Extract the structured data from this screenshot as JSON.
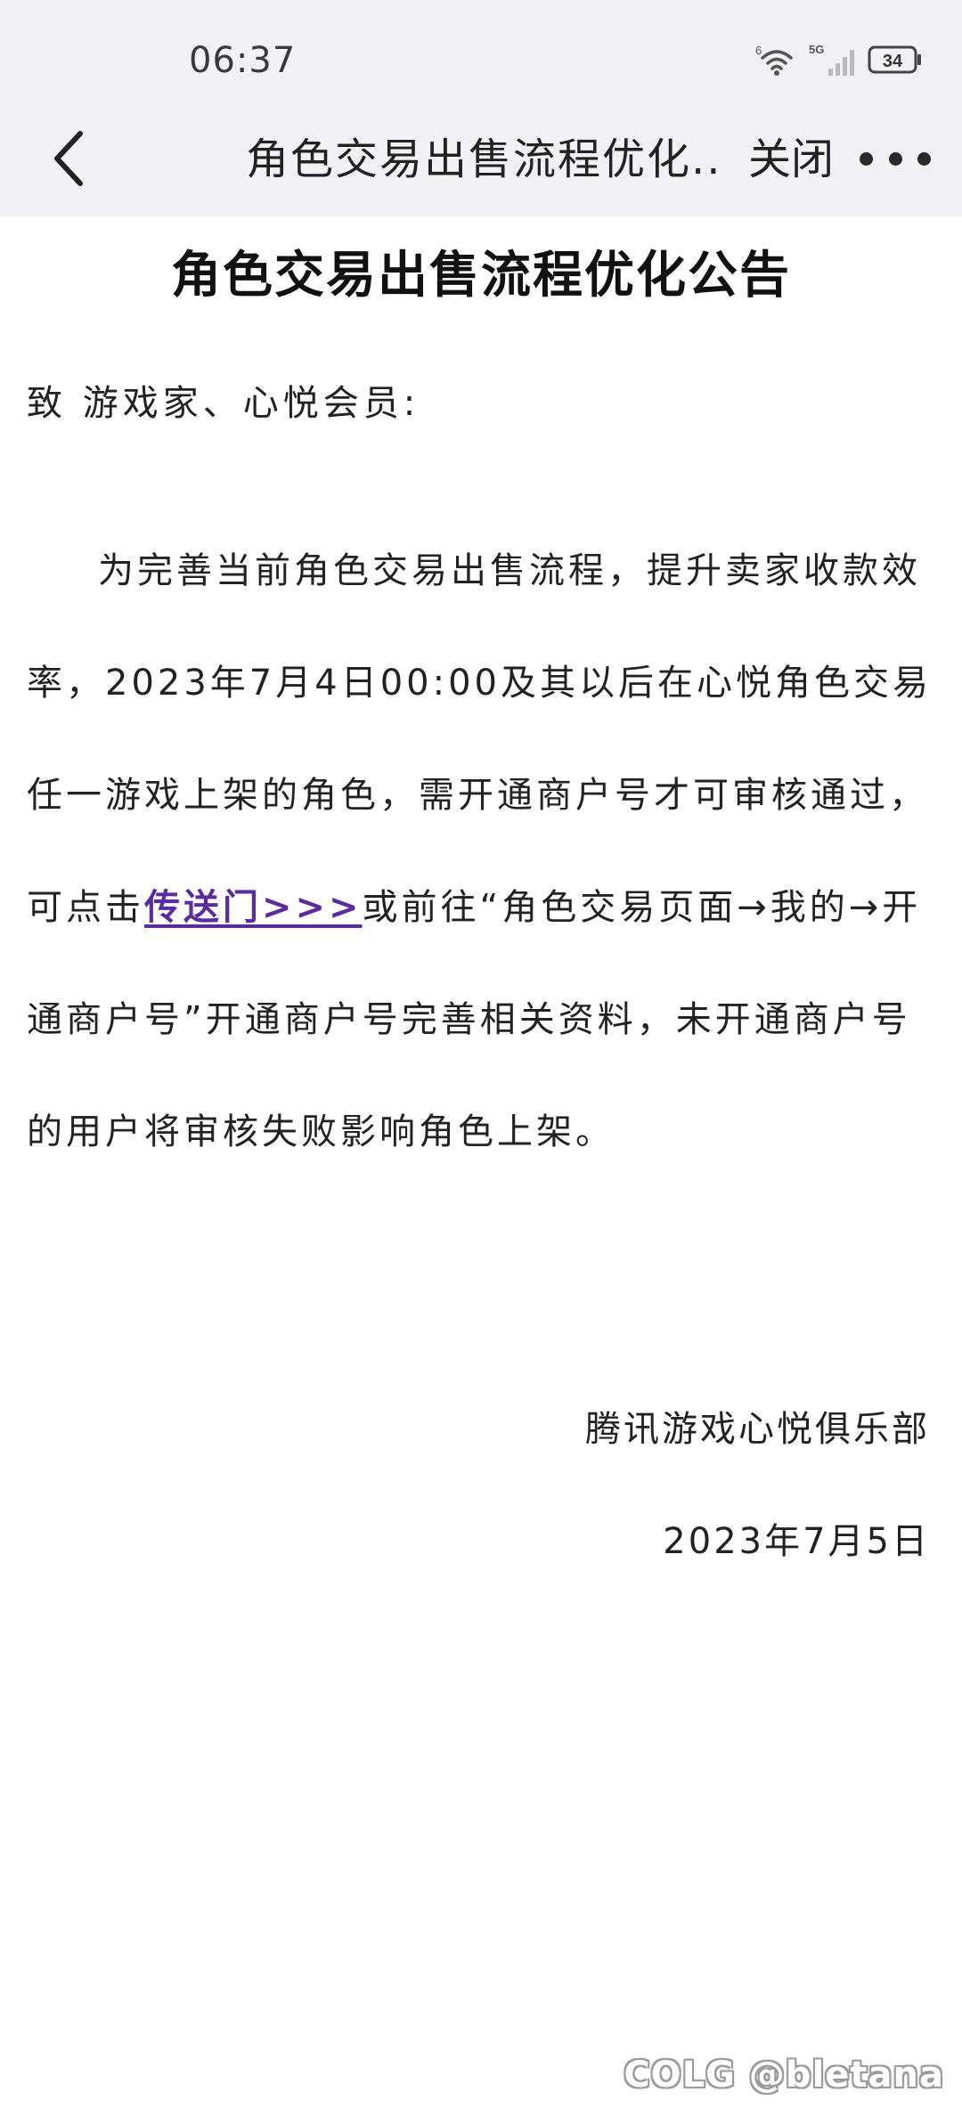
{
  "status_bar": {
    "time": "06:37",
    "wifi_label": "6",
    "network_label": "5G",
    "battery": "34"
  },
  "header": {
    "title": "角色交易出售流程优化...",
    "close_label": "关闭"
  },
  "article": {
    "title": "角色交易出售流程优化公告",
    "greeting": "致 游戏家、心悦会员:",
    "body_before_link": "为完善当前角色交易出售流程，提升卖家收款效率，2023年7月4日00:00及其以后在心悦角色交易任一游戏上架的角色，需开通商户号才可审核通过，可点击",
    "link_text": "传送门>>>",
    "body_after_link": "或前往“角色交易页面→我的→开通商户号”开通商户号完善相关资料，未开通商户号的用户将审核失败影响角色上架。",
    "signature_org": "腾讯游戏心悦俱乐部",
    "signature_date": "2023年7月5日"
  },
  "watermark": {
    "text": "COLG @bletana"
  },
  "colors": {
    "header_background": "#f2f2f4",
    "link": "#5b2ca0",
    "text": "#222222"
  }
}
